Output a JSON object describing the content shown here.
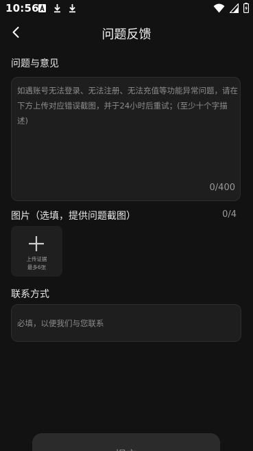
{
  "status_bar": {
    "time": "10:56",
    "left_icons": [
      "font-icon",
      "download-icon",
      "download-icon"
    ],
    "right_icons": [
      "wifi-icon",
      "signal-icon",
      "battery-icon"
    ]
  },
  "header": {
    "title": "问题反馈",
    "back_icon": "chevron-left-icon"
  },
  "feedback": {
    "label": "问题与意见",
    "placeholder": "如遇账号无法登录、无法注册、无法充值等功能异常问题，请在下方上传对应错误截图，并于24小时后重试；(至少十个字描述)",
    "value": "",
    "char_count": "0/400"
  },
  "images": {
    "label": "图片（选填，提供问题截图）",
    "count": "0/4",
    "upload_line1": "上传证据",
    "upload_line2": "最多6张",
    "upload_icon": "plus-icon"
  },
  "contact": {
    "label": "联系方式",
    "placeholder": "必填，以便我们与您联系",
    "value": ""
  },
  "submit": {
    "label": "提交"
  },
  "colors": {
    "background": "#121212",
    "field_background": "#1e1e1e",
    "button_background": "#2b2b2b",
    "text_primary": "#e8e8e8",
    "text_muted": "#8c8c8c"
  }
}
